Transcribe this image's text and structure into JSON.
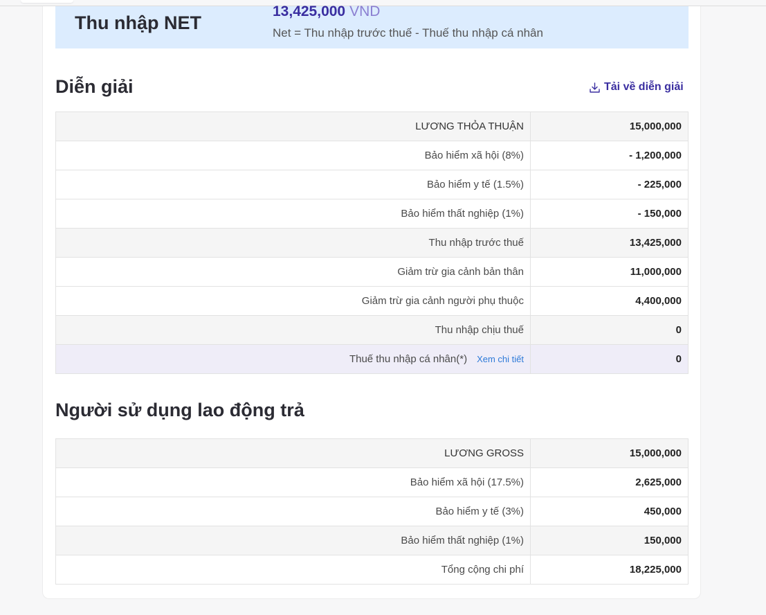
{
  "net": {
    "title": "Thu nhập NET",
    "value": "13,425,000",
    "currency": "VND",
    "formula": "Net = Thu nhập trước thuế - Thuế thu nhập cá nhân"
  },
  "explanation": {
    "title": "Diễn giải",
    "download_label": "Tải về diễn giải",
    "rows": [
      {
        "label": "LƯƠNG THỎA THUẬN",
        "value": "15,000,000"
      },
      {
        "label": "Bảo hiểm xã hội (8%)",
        "value": "- 1,200,000"
      },
      {
        "label": "Bảo hiểm y tế (1.5%)",
        "value": "- 225,000"
      },
      {
        "label": "Bảo hiểm thất nghiệp (1%)",
        "value": "- 150,000"
      },
      {
        "label": "Thu nhập trước thuế",
        "value": "13,425,000"
      },
      {
        "label": "Giảm trừ gia cảnh bản thân",
        "value": "11,000,000"
      },
      {
        "label": "Giảm trừ gia cảnh người phụ thuộc",
        "value": "4,400,000"
      },
      {
        "label": "Thu nhập chịu thuế",
        "value": "0"
      },
      {
        "label": "Thuế thu nhập cá nhân(*)",
        "link": "Xem chi tiết",
        "value": "0"
      }
    ]
  },
  "employer": {
    "title": "Người sử dụng lao động trả",
    "rows": [
      {
        "label": "LƯƠNG GROSS",
        "value": "15,000,000"
      },
      {
        "label": "Bảo hiểm xã hội (17.5%)",
        "value": "2,625,000"
      },
      {
        "label": "Bảo hiểm y tế (3%)",
        "value": "450,000"
      },
      {
        "label": "Bảo hiểm thất nghiệp (1%)",
        "value": "150,000"
      },
      {
        "label": "Tổng cộng chi phí",
        "value": "18,225,000"
      }
    ]
  },
  "icons": {
    "download": "download-icon"
  },
  "colors": {
    "accent": "#3a2ea0",
    "net_bg": "#dcecfe",
    "link": "#2d7ad8"
  }
}
